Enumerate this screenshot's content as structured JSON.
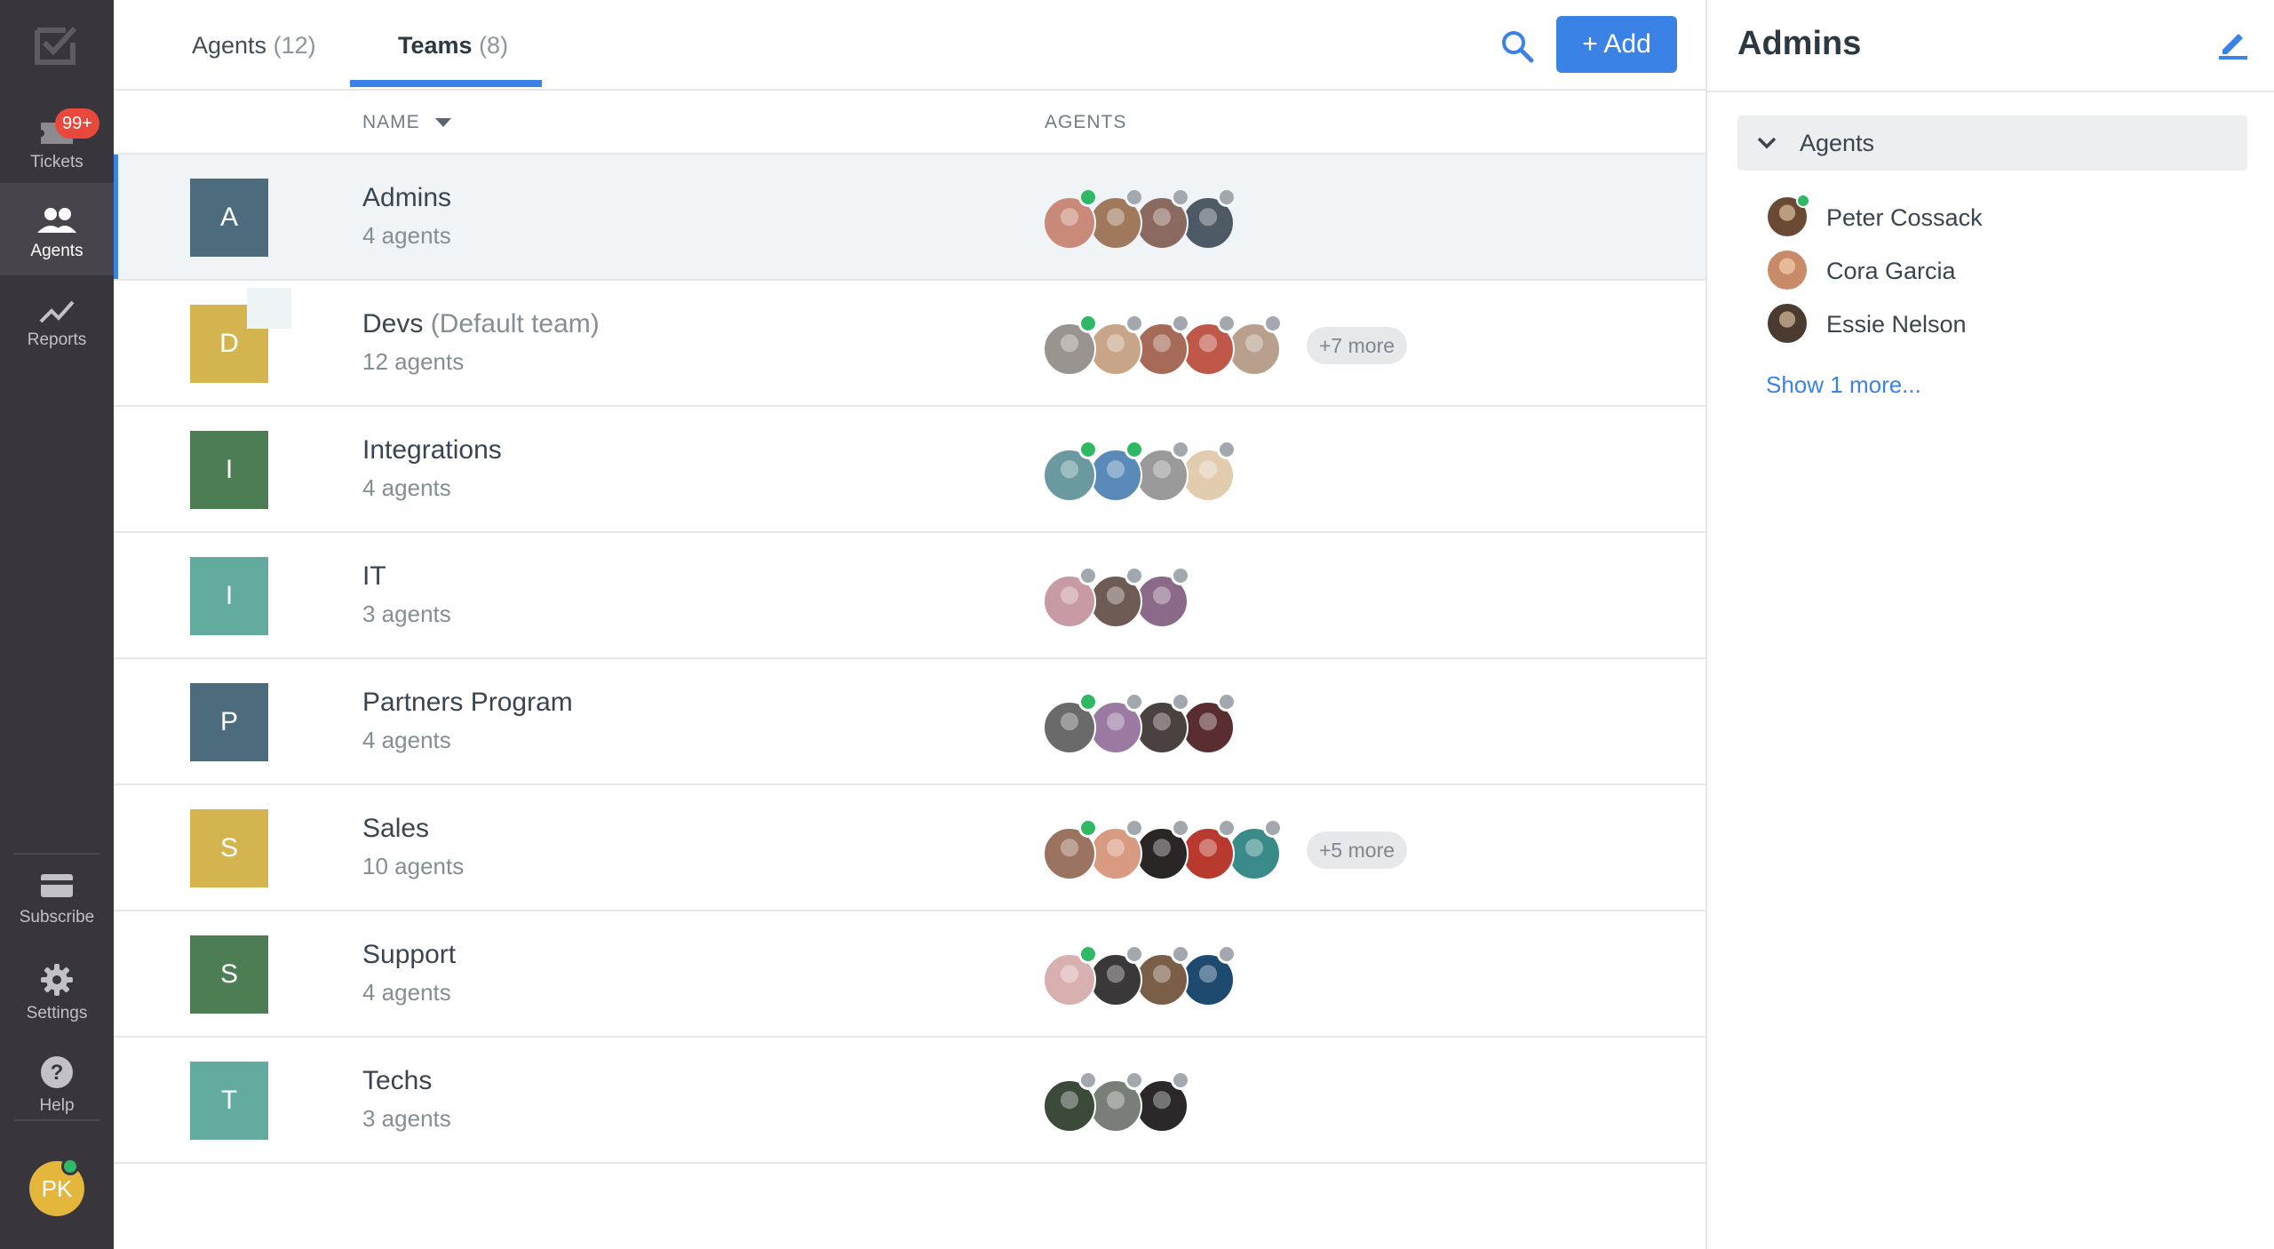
{
  "nav": {
    "items": [
      {
        "label": "Tickets",
        "icon": "ticket-icon",
        "badge": "99+"
      },
      {
        "label": "Agents",
        "icon": "agents-icon",
        "active": true
      },
      {
        "label": "Reports",
        "icon": "reports-icon"
      }
    ],
    "bottom_items": [
      {
        "label": "Subscribe",
        "icon": "card-icon"
      },
      {
        "label": "Settings",
        "icon": "gear-icon"
      },
      {
        "label": "Help",
        "icon": "help-icon"
      }
    ],
    "user_initials": "PK"
  },
  "tabs": [
    {
      "label": "Agents",
      "count": "(12)"
    },
    {
      "label": "Teams",
      "count": "(8)",
      "active": true
    }
  ],
  "toolbar": {
    "add_label": "+ Add"
  },
  "columns": {
    "name": "NAME",
    "agents": "AGENTS"
  },
  "teams": [
    {
      "letter": "A",
      "name": "Admins",
      "default": "",
      "sub": "4 agents",
      "color": "#4c6c7e",
      "selected": true,
      "avatars": [
        "#c98a7a",
        "#a0785c",
        "#8a6a60",
        "#4d5a66"
      ],
      "status": [
        "online",
        "away",
        "away",
        "away"
      ],
      "more": ""
    },
    {
      "letter": "D",
      "name": "Devs",
      "default": "(Default team)",
      "sub": "12 agents",
      "color": "#d4b44f",
      "avatars": [
        "#9a9490",
        "#c8a488",
        "#a66a58",
        "#c0584a",
        "#b8a08c"
      ],
      "status": [
        "online",
        "away",
        "away",
        "away",
        "away"
      ],
      "more": "+7 more"
    },
    {
      "letter": "I",
      "name": "Integrations",
      "default": "",
      "sub": "4 agents",
      "color": "#4d7d52",
      "avatars": [
        "#6a9aa0",
        "#5a8ab8",
        "#9a9a9a",
        "#e2ccb0"
      ],
      "status": [
        "online",
        "online",
        "away",
        "away"
      ],
      "more": ""
    },
    {
      "letter": "I",
      "name": "IT",
      "default": "",
      "sub": "3 agents",
      "color": "#63ab9f",
      "avatars": [
        "#c89aa4",
        "#6e5c54",
        "#8a6a88"
      ],
      "status": [
        "away",
        "away",
        "away"
      ],
      "more": ""
    },
    {
      "letter": "P",
      "name": "Partners Program",
      "default": "",
      "sub": "4 agents",
      "color": "#4c6c7e",
      "avatars": [
        "#6a6a6a",
        "#9a7aa0",
        "#4a4240",
        "#5a2e30"
      ],
      "status": [
        "online",
        "away",
        "away",
        "away"
      ],
      "more": ""
    },
    {
      "letter": "S",
      "name": "Sales",
      "default": "",
      "sub": "10 agents",
      "color": "#d4b44f",
      "avatars": [
        "#9a7460",
        "#d89a80",
        "#2a2626",
        "#b83a2e",
        "#3a8a8a"
      ],
      "status": [
        "online",
        "away",
        "away",
        "away",
        "away"
      ],
      "more": "+5 more"
    },
    {
      "letter": "S",
      "name": "Support",
      "default": "",
      "sub": "4 agents",
      "color": "#4d7d52",
      "avatars": [
        "#d8b0b0",
        "#3a3838",
        "#7a5e48",
        "#1e4a70"
      ],
      "status": [
        "online",
        "away",
        "away",
        "away"
      ],
      "more": ""
    },
    {
      "letter": "T",
      "name": "Techs",
      "default": "",
      "sub": "3 agents",
      "color": "#63ab9f",
      "avatars": [
        "#3c4a3a",
        "#7a7e78",
        "#2a2828"
      ],
      "status": [
        "away",
        "away",
        "away"
      ],
      "more": ""
    }
  ],
  "panel": {
    "title": "Admins",
    "section_label": "Agents",
    "members": [
      {
        "name": "Peter Cossack",
        "color": "#6a4a34",
        "online": true
      },
      {
        "name": "Cora Garcia",
        "color": "#c98a6a",
        "online": false
      },
      {
        "name": "Essie Nelson",
        "color": "#4a3a30",
        "online": false
      }
    ],
    "show_more": "Show 1 more..."
  },
  "colors": {
    "accent": "#3b82e6",
    "online": "#2fb965",
    "away": "#a3a8ae",
    "nav_bg": "#38363c"
  }
}
